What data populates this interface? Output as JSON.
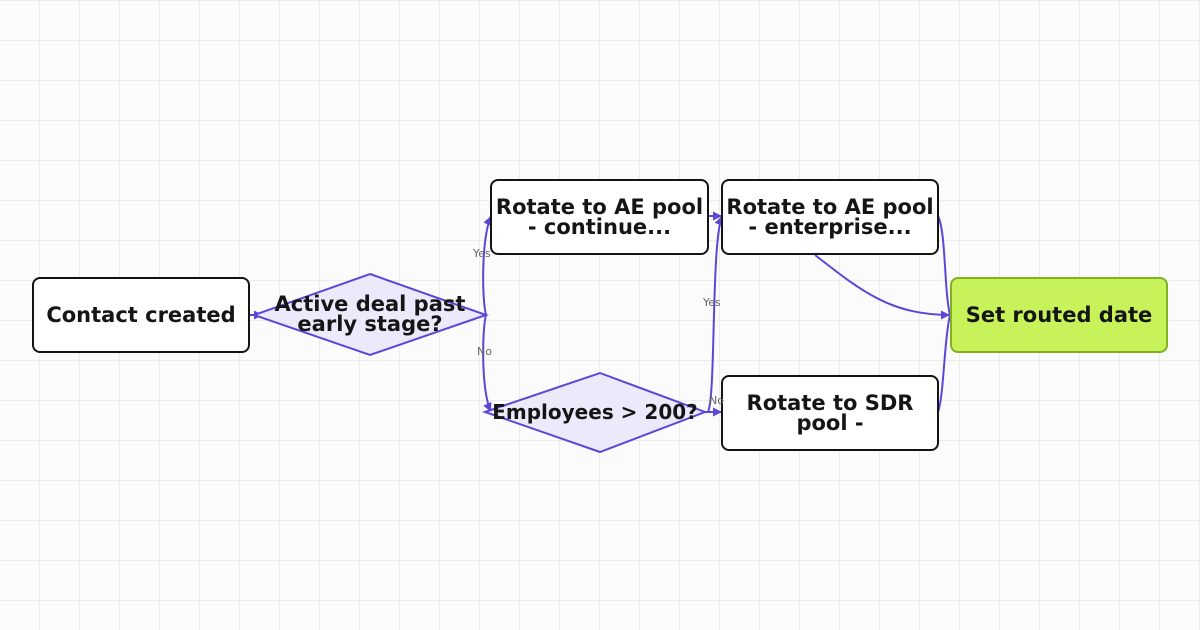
{
  "colors": {
    "edge": "#5b47d6",
    "node_border": "#141414",
    "node_fill": "#ffffff",
    "decision_fill": "#ece9fb",
    "decision_border": "#5b47d6",
    "end_fill": "#c8f25a",
    "end_border": "#7fb21e",
    "text": "#151515"
  },
  "nodes": {
    "contact_created": "Contact created",
    "active_deal": "Active deal past\nearly stage?",
    "rotate_ae_continue": "Rotate to AE pool\n- continue...",
    "employees": "Employees > 200?",
    "rotate_ae_enterprise": "Rotate to AE pool\n- enterprise...",
    "rotate_sdr": "Rotate to SDR\npool -",
    "set_routed_date": "Set routed date"
  },
  "edge_labels": {
    "deal_yes": "Yes",
    "deal_no": "No",
    "emp_yes": "Yes",
    "emp_no": "No"
  }
}
